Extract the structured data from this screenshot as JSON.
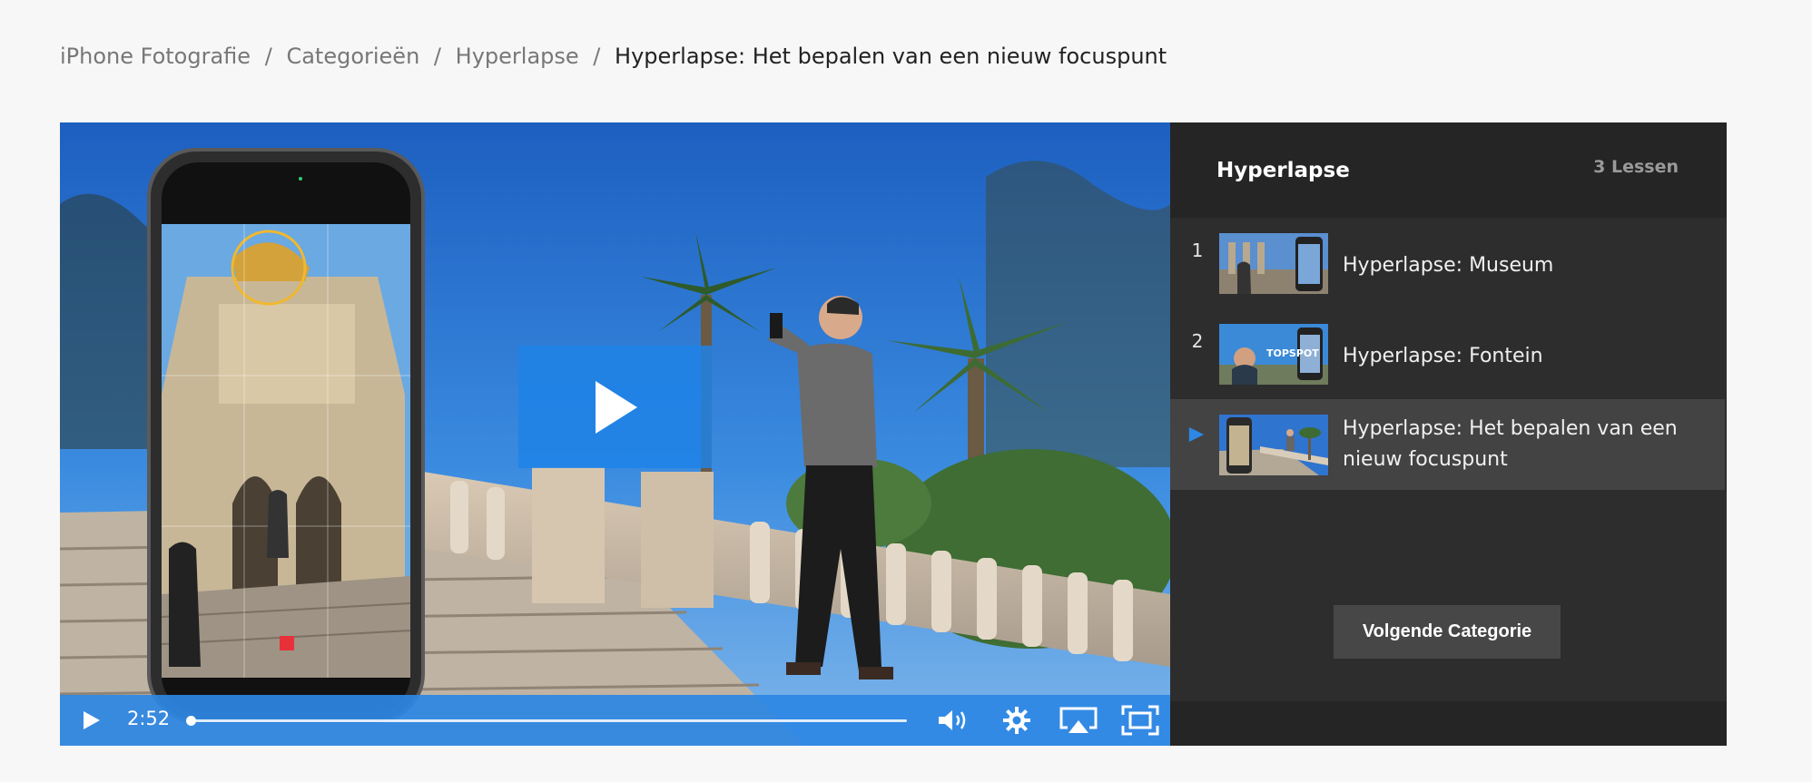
{
  "breadcrumb": {
    "items": [
      "iPhone Fotografie",
      "Categorieën",
      "Hyperlapse"
    ],
    "separator": "/",
    "current": "Hyperlapse: Het bepalen van een nieuw focuspunt"
  },
  "player": {
    "time": "2:52",
    "progress": 0.0,
    "accent_color": "#2d87e4",
    "icons": [
      "play-icon",
      "volume-icon",
      "settings-gear-icon",
      "airplay-icon",
      "fullscreen-icon"
    ]
  },
  "sidebar": {
    "title": "Hyperlapse",
    "count": "3 Lessen",
    "lessons": [
      {
        "number": "1",
        "title": "Hyperlapse: Museum",
        "active": false
      },
      {
        "number": "2",
        "title": "Hyperlapse: Fontein",
        "active": false,
        "thumb_text": "TOPSPOT"
      },
      {
        "number": "",
        "title": "Hyperlapse: Het bepalen van een nieuw focuspunt",
        "active": true
      }
    ],
    "next_button": "Volgende Categorie"
  }
}
